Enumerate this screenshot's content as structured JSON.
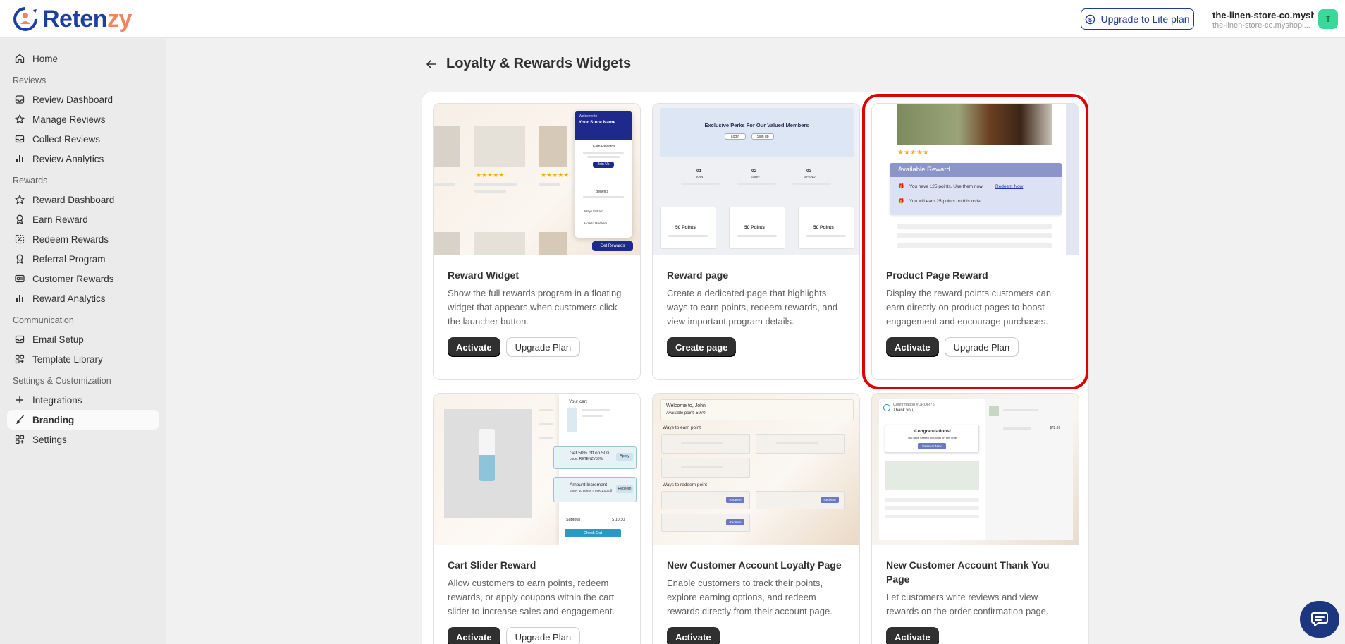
{
  "header": {
    "logo_part1": "Reten",
    "logo_part2": "zy",
    "upgrade_label": "Upgrade to Lite plan",
    "store_name": "the-linen-store-co.mysh...",
    "store_domain": "the-linen-store-co.myshopi...",
    "avatar_initial": "T"
  },
  "sidebar": {
    "home": "Home",
    "sections": {
      "reviews": "Reviews",
      "rewards": "Rewards",
      "communication": "Communication",
      "settings": "Settings & Customization"
    },
    "reviews": [
      "Review Dashboard",
      "Manage Reviews",
      "Collect Reviews",
      "Review Analytics"
    ],
    "rewards": [
      "Reward Dashboard",
      "Earn Reward",
      "Redeem Rewards",
      "Referral Program",
      "Customer Rewards",
      "Reward Analytics"
    ],
    "communication": [
      "Email Setup",
      "Template Library"
    ],
    "settings_items": [
      "Integrations",
      "Branding",
      "Settings"
    ]
  },
  "page": {
    "title": "Loyalty & Rewards Widgets"
  },
  "cards": [
    {
      "title": "Reward Widget",
      "desc": "Show the full rewards program in a floating widget that appears when customers click the launcher button.",
      "primary": "Activate",
      "secondary": "Upgrade Plan"
    },
    {
      "title": "Reward page",
      "desc": "Create a dedicated page that highlights ways to earn points, redeem rewards, and view important program details.",
      "primary": "Create page"
    },
    {
      "title": "Product Page Reward",
      "desc": "Display the reward points customers can earn directly on product pages to boost engagement and encourage purchases.",
      "primary": "Activate",
      "secondary": "Upgrade Plan"
    },
    {
      "title": "Cart Slider Reward",
      "desc": "Allow customers to earn points, redeem rewards, or apply coupons within the cart slider to increase sales and engagement.",
      "primary": "Activate",
      "secondary": "Upgrade Plan"
    },
    {
      "title": "New Customer Account Loyalty Page",
      "desc": "Enable customers to track their points, explore earning options, and redeem rewards directly from their account page.",
      "primary": "Activate"
    },
    {
      "title": "New Customer Account Thank You Page",
      "desc": "Let customers write reviews and view rewards on the order confirmation page.",
      "primary": "Activate"
    }
  ],
  "previews": {
    "widget": {
      "welcome": "Welcome to",
      "store": "Your Store Name",
      "earn": "Earn Rewards",
      "join_btn": "Join Us",
      "benefits": "Benefits",
      "way_to_earn": "Ways to Earn",
      "way_to_redeem": "How to Redeem",
      "launcher": "Get Rewards"
    },
    "reward_page": {
      "heading": "Exclusive Perks For Our Valued Members",
      "login": "Login",
      "signup": "Sign up",
      "steps": [
        {
          "num": "01",
          "label": "JOIN"
        },
        {
          "num": "02",
          "label": "EARN"
        },
        {
          "num": "03",
          "label": "SPEND"
        }
      ],
      "points": [
        "50 Points",
        "50 Points",
        "50 Points"
      ]
    },
    "product_page": {
      "available": "Available Reward",
      "line1": "You have 125 points. Use them now",
      "redeem_link": "Redeem Now",
      "line2": "You will earn 25 points on this order"
    },
    "cart": {
      "your_cart": "Your cart",
      "offer_title": "Get 50% off on 500",
      "offer_code": "code: RETENZY50%",
      "apply": "Apply",
      "increment_title": "Amount Increment",
      "increment_sub": "Every 10 points = INR 1.00 off",
      "redeem": "Redeem",
      "subtotal": "Subtotal",
      "subtotal_value": "$ 10.30",
      "checkout": "Check Out"
    },
    "account": {
      "welcome": "Welcome to, John",
      "available": "Available point: 5970",
      "earn": "Ways to earn point",
      "redeem": "Ways to redeem point",
      "redeem_btn": "Redeem"
    },
    "thankyou": {
      "confirmation": "Confirmation #URQHY5",
      "thanks": "Thank you,",
      "congrats": "Congratulations!",
      "earned": "You have earned 50 points on this order",
      "redeem_btn": "Redeem Now",
      "price": "$72.99"
    }
  },
  "colors": {
    "brand_blue": "#1f3fa0",
    "brand_orange": "#f0845c",
    "highlight": "#e00000",
    "dark_button": "#303030"
  }
}
